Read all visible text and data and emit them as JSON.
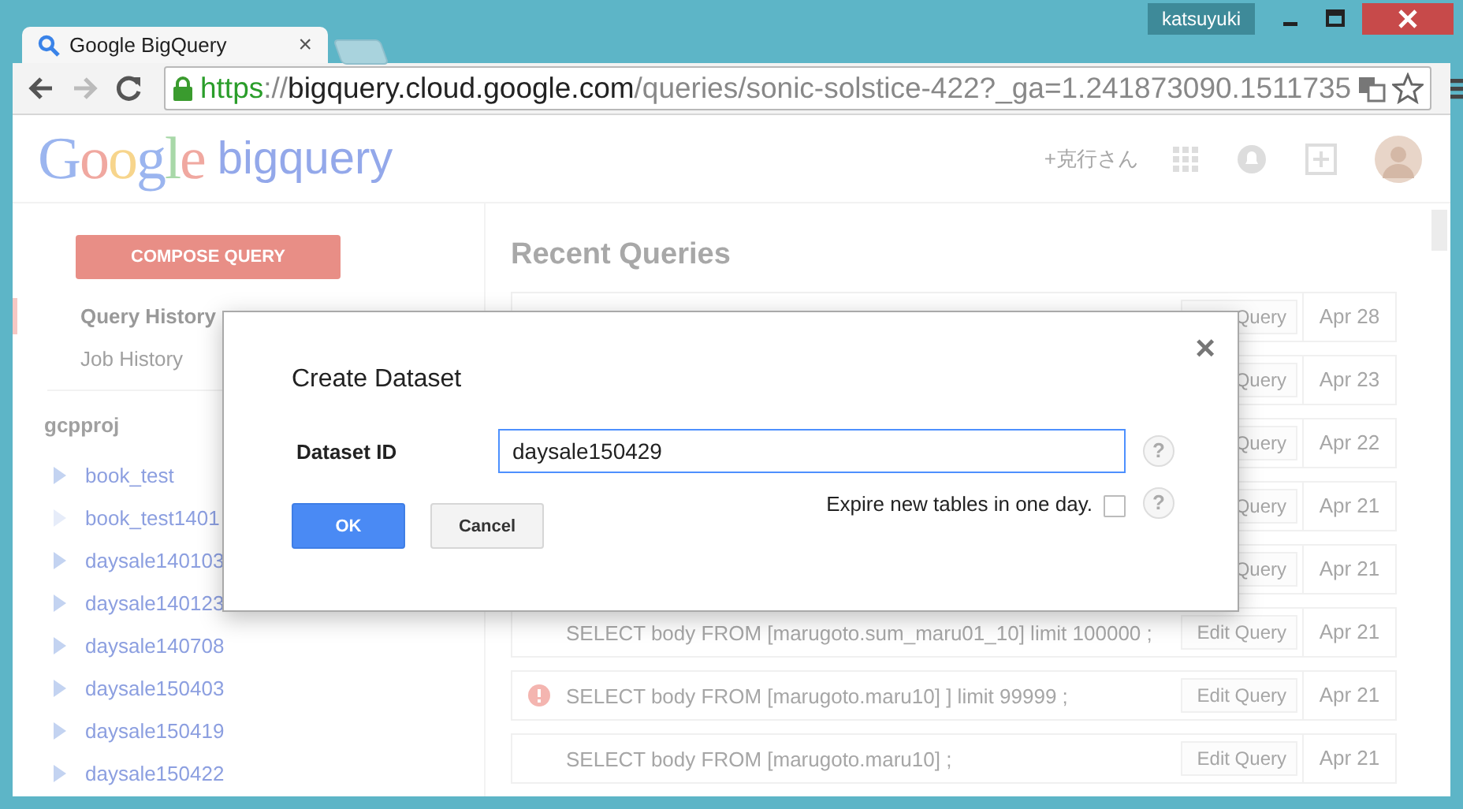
{
  "browser": {
    "user": "katsuyuki",
    "tab_title": "Google BigQuery",
    "tab_close": "×",
    "url": [
      {
        "text": "https",
        "kind": "scheme"
      },
      {
        "text": "://",
        "kind": "sep"
      },
      {
        "text": "bigquery.cloud.google.com",
        "kind": "host"
      },
      {
        "text": "/queries/sonic-solstice-422?_ga=1.241873090.1511735",
        "kind": "path"
      }
    ]
  },
  "header": {
    "logo": "Google",
    "product": "bigquery",
    "user": "+克行さん"
  },
  "sidebar": {
    "compose": "COMPOSE QUERY",
    "nav": [
      {
        "label": "Query History",
        "selected": true
      },
      {
        "label": "Job History",
        "selected": false
      }
    ],
    "project": "gcpproj",
    "datasets": [
      {
        "name": "book_test",
        "expandable": true
      },
      {
        "name": "book_test1401",
        "expandable": false
      },
      {
        "name": "daysale140103",
        "expandable": true
      },
      {
        "name": "daysale140123",
        "expandable": true
      },
      {
        "name": "daysale140708",
        "expandable": true
      },
      {
        "name": "daysale150403",
        "expandable": true
      },
      {
        "name": "daysale150419",
        "expandable": true
      },
      {
        "name": "daysale150422",
        "expandable": true
      }
    ]
  },
  "main": {
    "title": "Recent Queries",
    "queries": [
      {
        "edit": "Query",
        "date": "Apr 28"
      },
      {
        "edit": "Query",
        "date": "Apr 23"
      },
      {
        "edit": "Query",
        "date": "Apr 22"
      },
      {
        "edit": "Query",
        "date": "Apr 21"
      },
      {
        "edit": "Query",
        "date": "Apr 21"
      },
      {
        "text": "SELECT body FROM [marugoto.sum_maru01_10] limit 100000 ;",
        "edit": "Edit Query",
        "date": "Apr 21",
        "error": false
      },
      {
        "text": "SELECT body FROM [marugoto.maru10] ] limit 99999 ;",
        "edit": "Edit Query",
        "date": "Apr 21",
        "error": true
      },
      {
        "text": "SELECT body FROM [marugoto.maru10] ;",
        "edit": "Edit Query",
        "date": "Apr 21",
        "error": false
      }
    ]
  },
  "dialog": {
    "title": "Create Dataset",
    "close": "×",
    "field": {
      "label": "Dataset ID",
      "value": "daysale150429",
      "help": "?"
    },
    "expire": {
      "label": "Expire new tables in one day.",
      "checked": false,
      "help": "?"
    },
    "buttons": [
      {
        "label": "OK",
        "kind": "primary"
      },
      {
        "label": "Cancel",
        "kind": "secondary"
      }
    ]
  }
}
